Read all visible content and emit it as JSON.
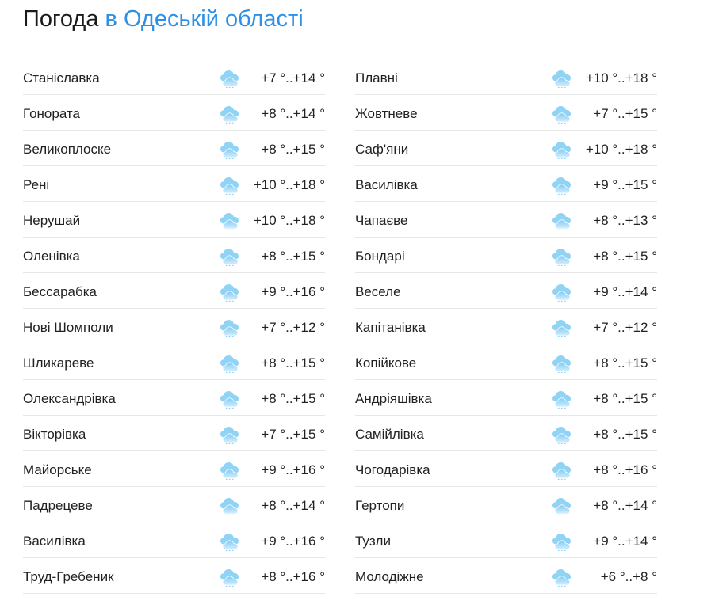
{
  "header": {
    "title_main": "Погода",
    "title_accent": "в Одеській області"
  },
  "icons": {
    "weather": "cloudy-rain-icon",
    "cloud_color_top": "#7ecbf3",
    "cloud_color_bottom": "#d7eefb"
  },
  "columns": [
    {
      "rows": [
        {
          "name": "Станіславка",
          "temp": "+7 °..+14 °"
        },
        {
          "name": "Гонората",
          "temp": "+8 °..+14 °"
        },
        {
          "name": "Великоплоске",
          "temp": "+8 °..+15 °"
        },
        {
          "name": "Рені",
          "temp": "+10 °..+18 °"
        },
        {
          "name": "Нерушай",
          "temp": "+10 °..+18 °"
        },
        {
          "name": "Оленівка",
          "temp": "+8 °..+15 °"
        },
        {
          "name": "Бессарабка",
          "temp": "+9 °..+16 °"
        },
        {
          "name": "Нові Шомполи",
          "temp": "+7 °..+12 °"
        },
        {
          "name": "Шликареве",
          "temp": "+8 °..+15 °"
        },
        {
          "name": "Олександрівка",
          "temp": "+8 °..+15 °"
        },
        {
          "name": "Вікторівка",
          "temp": "+7 °..+15 °"
        },
        {
          "name": "Майорське",
          "temp": "+9 °..+16 °"
        },
        {
          "name": "Падрецеве",
          "temp": "+8 °..+14 °"
        },
        {
          "name": "Василівка",
          "temp": "+9 °..+16 °"
        },
        {
          "name": "Труд-Гребеник",
          "temp": "+8 °..+16 °"
        }
      ]
    },
    {
      "rows": [
        {
          "name": "Плавні",
          "temp": "+10 °..+18 °"
        },
        {
          "name": "Жовтневе",
          "temp": "+7 °..+15 °"
        },
        {
          "name": "Саф'яни",
          "temp": "+10 °..+18 °"
        },
        {
          "name": "Василівка",
          "temp": "+9 °..+15 °"
        },
        {
          "name": "Чапаєве",
          "temp": "+8 °..+13 °"
        },
        {
          "name": "Бондарі",
          "temp": "+8 °..+15 °"
        },
        {
          "name": "Веселе",
          "temp": "+9 °..+14 °"
        },
        {
          "name": "Капітанівка",
          "temp": "+7 °..+12 °"
        },
        {
          "name": "Копійкове",
          "temp": "+8 °..+15 °"
        },
        {
          "name": "Андріяшівка",
          "temp": "+8 °..+15 °"
        },
        {
          "name": "Самійлівка",
          "temp": "+8 °..+15 °"
        },
        {
          "name": "Чогодарівка",
          "temp": "+8 °..+16 °"
        },
        {
          "name": "Гертопи",
          "temp": "+8 °..+14 °"
        },
        {
          "name": "Тузли",
          "temp": "+9 °..+14 °"
        },
        {
          "name": "Молодіжне",
          "temp": "+6 °..+8 °"
        }
      ]
    }
  ]
}
